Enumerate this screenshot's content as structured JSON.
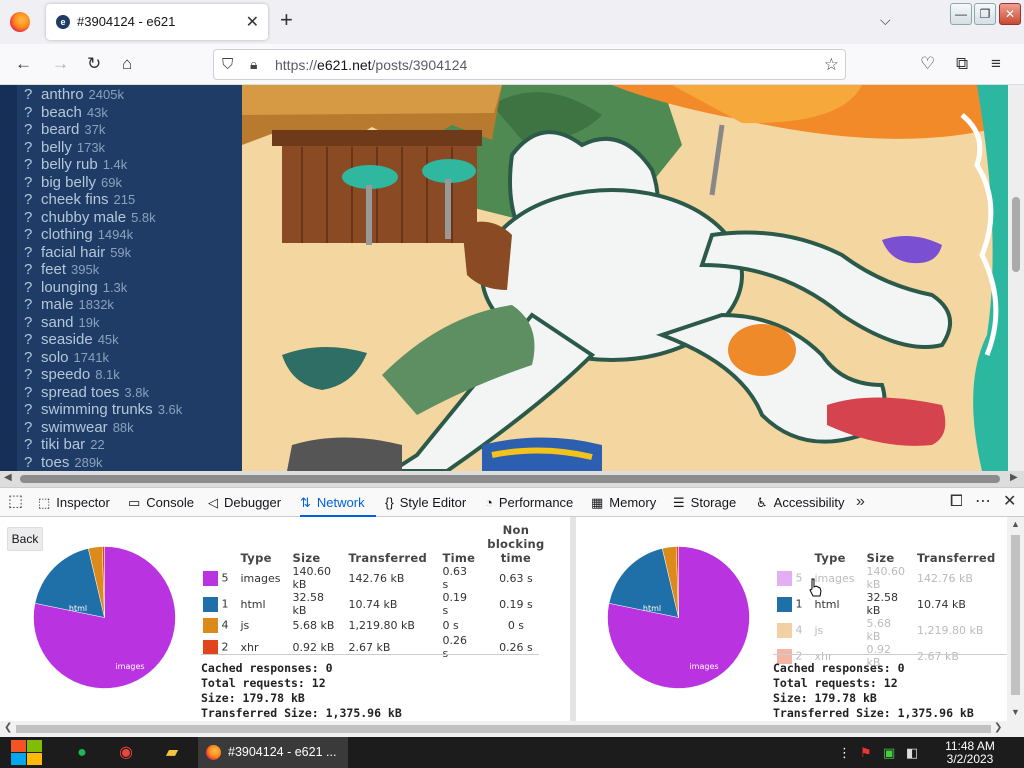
{
  "browser": {
    "tab_title": "#3904124 - e621",
    "tab_favicon_letter": "e",
    "url_host": "e621.net",
    "url_prefix": "https://",
    "url_path": "/posts/3904124",
    "icons": [
      "firefox-logo",
      "close-icon",
      "plus-icon",
      "chevron-down-icon",
      "minimize-icon",
      "maximize-icon",
      "window-close-icon",
      "back-icon",
      "forward-icon",
      "reload-icon",
      "home-icon",
      "shield-icon",
      "lock-icon",
      "star-icon",
      "pocket-icon",
      "extensions-icon",
      "menu-icon"
    ]
  },
  "tags": [
    {
      "q": "?",
      "name": "anthro",
      "count": "2405k"
    },
    {
      "q": "?",
      "name": "beach",
      "count": "43k"
    },
    {
      "q": "?",
      "name": "beard",
      "count": "37k"
    },
    {
      "q": "?",
      "name": "belly",
      "count": "173k"
    },
    {
      "q": "?",
      "name": "belly rub",
      "count": "1.4k"
    },
    {
      "q": "?",
      "name": "big belly",
      "count": "69k"
    },
    {
      "q": "?",
      "name": "cheek fins",
      "count": "215"
    },
    {
      "q": "?",
      "name": "chubby male",
      "count": "5.8k"
    },
    {
      "q": "?",
      "name": "clothing",
      "count": "1494k"
    },
    {
      "q": "?",
      "name": "facial hair",
      "count": "59k"
    },
    {
      "q": "?",
      "name": "feet",
      "count": "395k"
    },
    {
      "q": "?",
      "name": "lounging",
      "count": "1.3k"
    },
    {
      "q": "?",
      "name": "male",
      "count": "1832k"
    },
    {
      "q": "?",
      "name": "sand",
      "count": "19k"
    },
    {
      "q": "?",
      "name": "seaside",
      "count": "45k"
    },
    {
      "q": "?",
      "name": "solo",
      "count": "1741k"
    },
    {
      "q": "?",
      "name": "speedo",
      "count": "8.1k"
    },
    {
      "q": "?",
      "name": "spread toes",
      "count": "3.8k"
    },
    {
      "q": "?",
      "name": "swimming trunks",
      "count": "3.6k"
    },
    {
      "q": "?",
      "name": "swimwear",
      "count": "88k"
    },
    {
      "q": "?",
      "name": "tiki bar",
      "count": "22"
    },
    {
      "q": "?",
      "name": "toes",
      "count": "289k"
    }
  ],
  "devtools": {
    "tabs": [
      {
        "icon": "⬚",
        "label": "Inspector"
      },
      {
        "icon": "▭",
        "label": "Console"
      },
      {
        "icon": "◁",
        "label": "Debugger"
      },
      {
        "icon": "⇅",
        "label": "Network",
        "active": true
      },
      {
        "icon": "{}",
        "label": "Style Editor"
      },
      {
        "icon": "◔",
        "label": "Performance"
      },
      {
        "icon": "▦",
        "label": "Memory"
      },
      {
        "icon": "☰",
        "label": "Storage"
      },
      {
        "icon": "♿",
        "label": "Accessibility"
      }
    ],
    "more": "»",
    "back_label": "Back",
    "headers": {
      "type": "Type",
      "size": "Size",
      "transferred": "Transferred",
      "time": "Time",
      "nonblocking": "Non blocking time"
    },
    "rows": [
      {
        "count": "5",
        "type": "images",
        "size": "140.60 kB",
        "transferred": "142.76 kB",
        "time": "0.63 s",
        "nonblocking": "0.63 s",
        "color": "#b934e0"
      },
      {
        "count": "1",
        "type": "html",
        "size": "32.58 kB",
        "transferred": "10.74 kB",
        "time": "0.19 s",
        "nonblocking": "0.19 s",
        "color": "#1f6fa8"
      },
      {
        "count": "4",
        "type": "js",
        "size": "5.68 kB",
        "transferred": "1,219.80 kB",
        "time": "0 s",
        "nonblocking": "0 s",
        "color": "#dc8a1a"
      },
      {
        "count": "2",
        "type": "xhr",
        "size": "0.92 kB",
        "transferred": "2.67 kB",
        "time": "0.26 s",
        "nonblocking": "0.26 s",
        "color": "#e2451c"
      }
    ],
    "summary": {
      "cached": "Cached responses: 0",
      "total": "Total requests: 12",
      "size": "Size: 179.78 kB",
      "transferred": "Transferred Size: 1,375.96 kB"
    },
    "pie_labels": {
      "images": "images",
      "html": "html"
    },
    "pie_values": [
      140.6,
      32.58,
      5.68,
      0.92
    ]
  },
  "taskbar": {
    "active_window": "#3904124 - e621 ...",
    "time": "11:48 AM",
    "date": "3/2/2023"
  }
}
